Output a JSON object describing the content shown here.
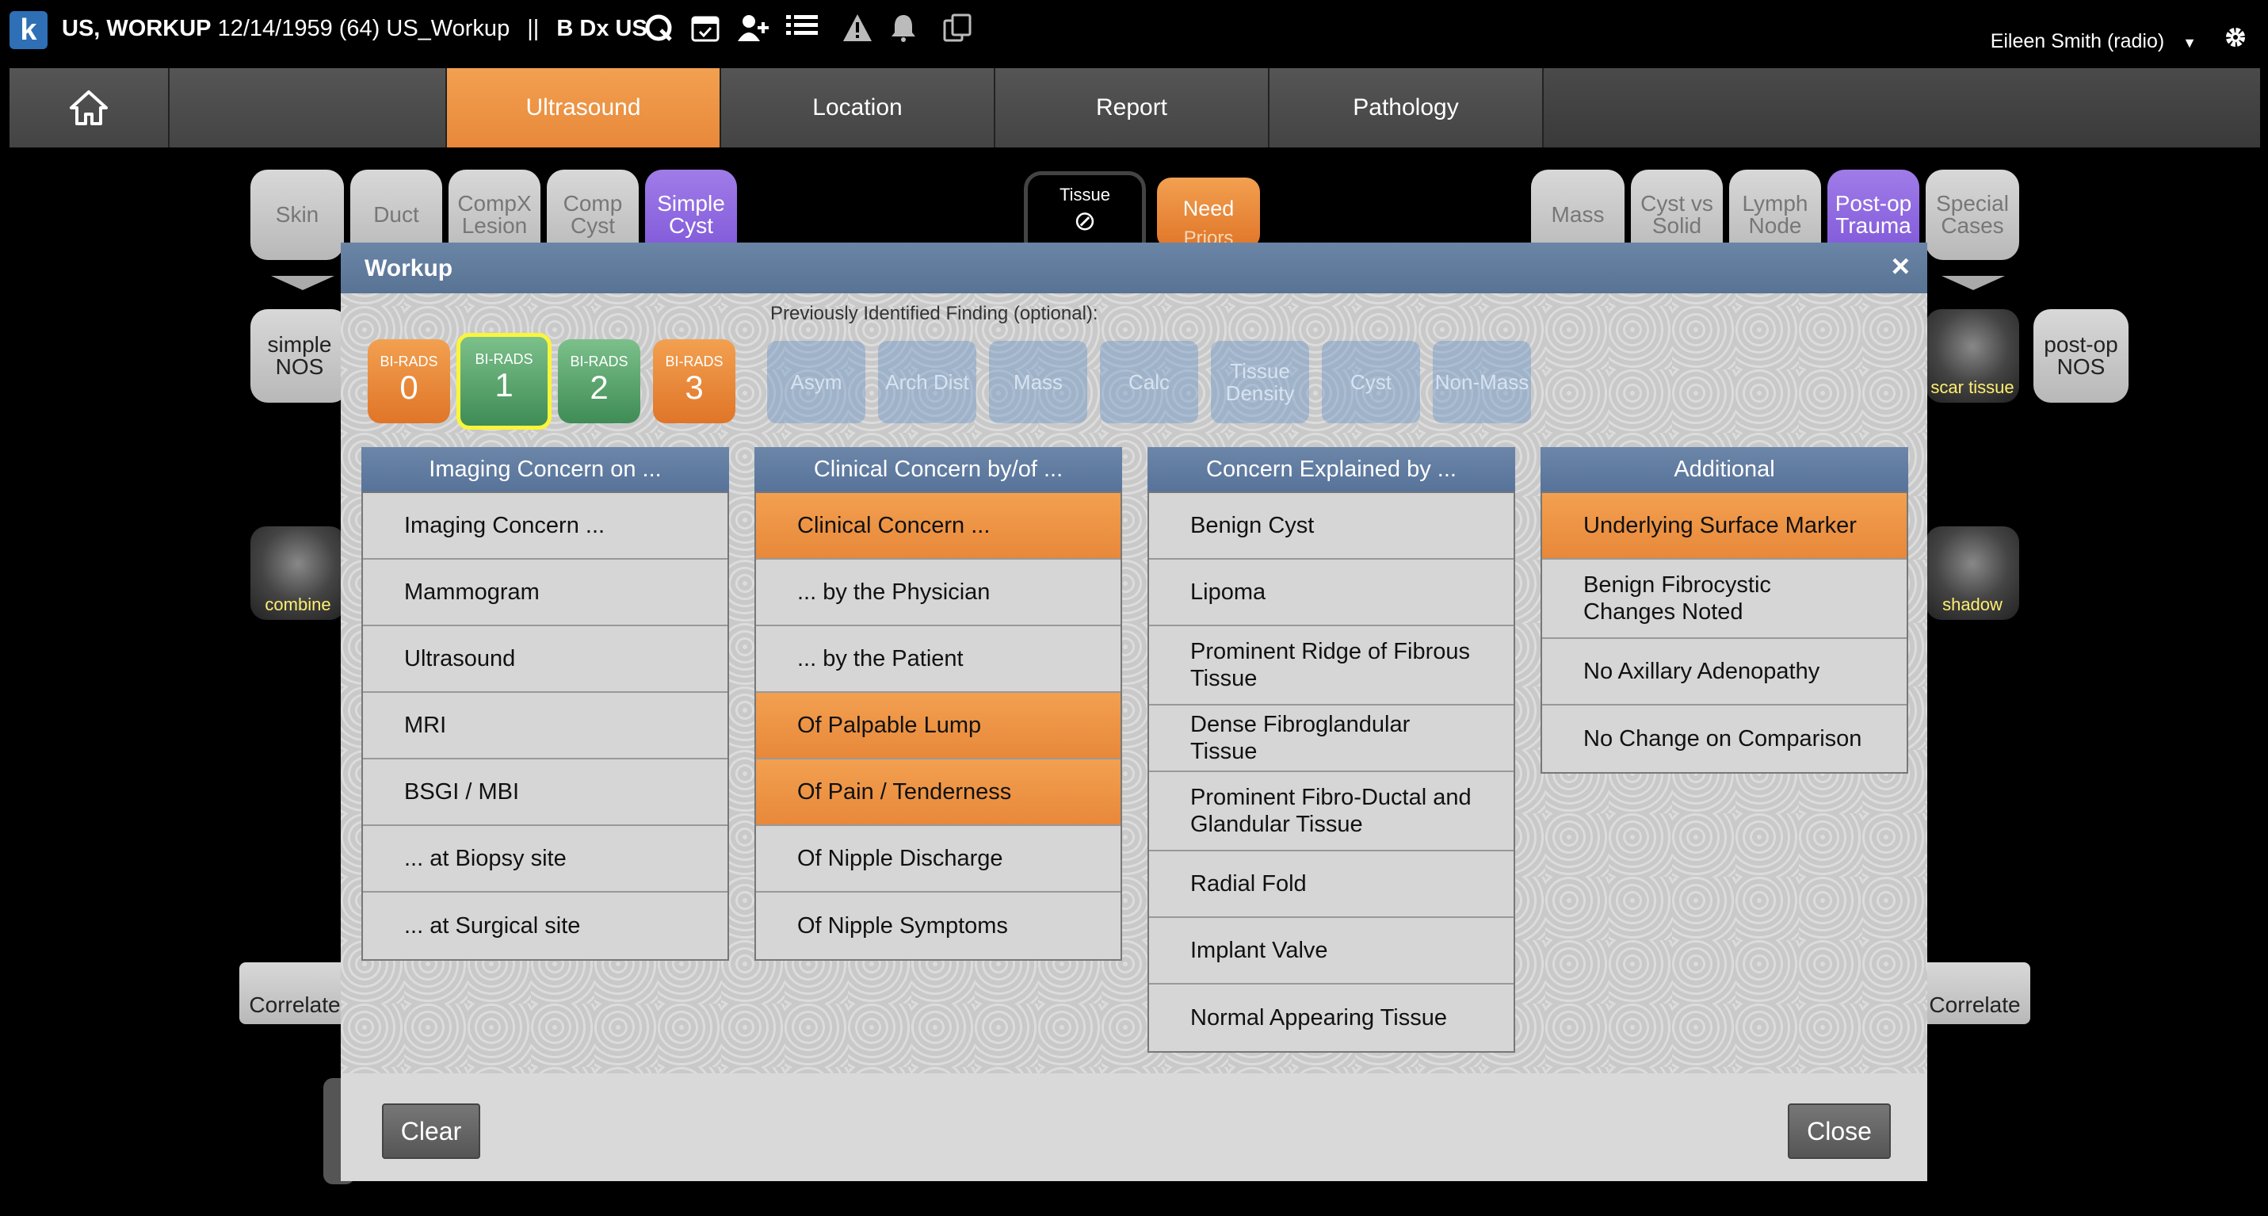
{
  "topbar": {
    "logo": "k",
    "patient_name": "US, WORKUP",
    "patient_info": "12/14/1959 (64) US_Workup",
    "separator": "||",
    "exam": "B Dx US",
    "icons": [
      "search-q-icon",
      "calendar-icon",
      "add-user-icon",
      "list-icon",
      "warning-icon",
      "bell-icon",
      "copy-icon"
    ],
    "user": "Eileen Smith (radio)",
    "user_caret": "▼",
    "settings_icon": "gear-icon"
  },
  "tabs": [
    "Ultrasound",
    "Location",
    "Report",
    "Pathology"
  ],
  "active_tab": "Ultrasound",
  "background": {
    "left_buttons": [
      "Skin",
      "Duct",
      "CompX Lesion",
      "Comp Cyst",
      "Simple Cyst"
    ],
    "tissue_label": "Tissue",
    "need_label": "Need",
    "need_sub": "Priors",
    "right_buttons": [
      "Mass",
      "Cyst vs Solid",
      "Lymph Node",
      "Post-op Trauma",
      "Special Cases"
    ],
    "simple_nos": "simple NOS",
    "postop_nos": "post-op NOS",
    "thumb_combine": "combine",
    "thumb_scar": "scar tissue",
    "thumb_shadow": "shadow",
    "correlate": "Correlate"
  },
  "modal": {
    "title": "Workup",
    "close_icon": "×",
    "previous_label": "Previously Identified Finding (optional):",
    "birads": [
      {
        "label": "BI-RADS",
        "value": "0",
        "color": "#e8883a",
        "selected": false
      },
      {
        "label": "BI-RADS",
        "value": "1",
        "color": "#4f9c63",
        "selected": true
      },
      {
        "label": "BI-RADS",
        "value": "2",
        "color": "#4f9c63",
        "selected": false
      },
      {
        "label": "BI-RADS",
        "value": "3",
        "color": "#e8883a",
        "selected": false
      }
    ],
    "findings": [
      "Asym",
      "Arch Dist",
      "Mass",
      "Calc",
      "Tissue Density",
      "Cyst",
      "Non-Mass"
    ],
    "columns": [
      {
        "header": "Imaging Concern on ...",
        "items": [
          {
            "label": "Imaging Concern ...",
            "on": false
          },
          {
            "label": "Mammogram",
            "on": false
          },
          {
            "label": "Ultrasound",
            "on": false
          },
          {
            "label": "MRI",
            "on": false
          },
          {
            "label": "BSGI / MBI",
            "on": false
          },
          {
            "label": "... at Biopsy site",
            "on": false
          },
          {
            "label": "... at Surgical site",
            "on": false
          }
        ]
      },
      {
        "header": "Clinical Concern by/of ...",
        "items": [
          {
            "label": "Clinical Concern ...",
            "on": true
          },
          {
            "label": "... by the Physician",
            "on": false
          },
          {
            "label": "... by the Patient",
            "on": false
          },
          {
            "label": "Of Palpable Lump",
            "on": true
          },
          {
            "label": "Of Pain / Tenderness",
            "on": true
          },
          {
            "label": "Of Nipple Discharge",
            "on": false
          },
          {
            "label": "Of Nipple Symptoms",
            "on": false
          }
        ]
      },
      {
        "header": "Concern Explained by ...",
        "items": [
          {
            "label": "Benign Cyst",
            "on": false
          },
          {
            "label": "Lipoma",
            "on": false
          },
          {
            "label": "Prominent Ridge of Fibrous Tissue",
            "on": false
          },
          {
            "label": "Dense Fibroglandular Tissue",
            "on": false
          },
          {
            "label": "Prominent Fibro-Ductal and Glandular Tissue",
            "on": false
          },
          {
            "label": "Radial Fold",
            "on": false
          },
          {
            "label": "Implant Valve",
            "on": false
          },
          {
            "label": "Normal Appearing Tissue",
            "on": false
          }
        ]
      },
      {
        "header": "Additional",
        "items": [
          {
            "label": "Underlying Surface Marker",
            "on": true
          },
          {
            "label": "Benign Fibrocystic Changes Noted",
            "on": false
          },
          {
            "label": "No Axillary Adenopathy",
            "on": false
          },
          {
            "label": "No Change on Comparison",
            "on": false
          }
        ]
      }
    ],
    "clear_label": "Clear",
    "close_label": "Close"
  }
}
